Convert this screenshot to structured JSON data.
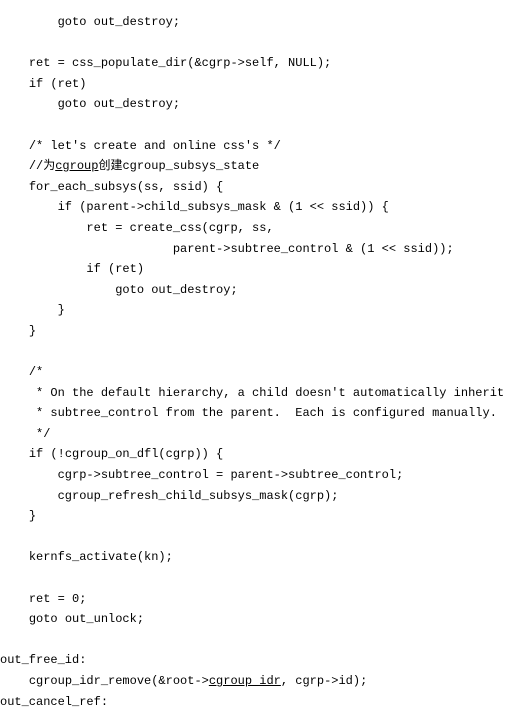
{
  "lines": [
    {
      "indent": 8,
      "segments": [
        {
          "t": "goto out_destroy;"
        }
      ]
    },
    {
      "blank": true
    },
    {
      "indent": 4,
      "segments": [
        {
          "t": "ret = css_populate_dir(&cgrp->self, NULL);"
        }
      ]
    },
    {
      "indent": 4,
      "segments": [
        {
          "t": "if (ret)"
        }
      ]
    },
    {
      "indent": 8,
      "segments": [
        {
          "t": "goto out_destroy;"
        }
      ]
    },
    {
      "blank": true
    },
    {
      "indent": 4,
      "segments": [
        {
          "t": "/* let's create and online css's */"
        }
      ]
    },
    {
      "indent": 4,
      "segments": [
        {
          "t": "//为"
        },
        {
          "t": "cgroup",
          "u": true
        },
        {
          "t": "创建cgroup_subsys_state"
        }
      ]
    },
    {
      "indent": 4,
      "segments": [
        {
          "t": "for_each_subsys(ss, ssid) {"
        }
      ]
    },
    {
      "indent": 8,
      "segments": [
        {
          "t": "if (parent->child_subsys_mask & (1 << ssid)) {"
        }
      ]
    },
    {
      "indent": 12,
      "segments": [
        {
          "t": "ret = create_css(cgrp, ss,"
        }
      ]
    },
    {
      "indent": 24,
      "segments": [
        {
          "t": "parent->subtree_control & (1 << ssid));"
        }
      ]
    },
    {
      "indent": 12,
      "segments": [
        {
          "t": "if (ret)"
        }
      ]
    },
    {
      "indent": 16,
      "segments": [
        {
          "t": "goto out_destroy;"
        }
      ]
    },
    {
      "indent": 8,
      "segments": [
        {
          "t": "}"
        }
      ]
    },
    {
      "indent": 4,
      "segments": [
        {
          "t": "}"
        }
      ]
    },
    {
      "blank": true
    },
    {
      "indent": 4,
      "segments": [
        {
          "t": "/*"
        }
      ]
    },
    {
      "indent": 5,
      "segments": [
        {
          "t": "* On the default hierarchy, a child doesn't automatically inherit"
        }
      ]
    },
    {
      "indent": 5,
      "segments": [
        {
          "t": "* subtree_control from the parent.  Each is configured manually."
        }
      ]
    },
    {
      "indent": 5,
      "segments": [
        {
          "t": "*/"
        }
      ]
    },
    {
      "indent": 4,
      "segments": [
        {
          "t": "if (!cgroup_on_dfl(cgrp)) {"
        }
      ]
    },
    {
      "indent": 8,
      "segments": [
        {
          "t": "cgrp->subtree_control = parent->subtree_control;"
        }
      ]
    },
    {
      "indent": 8,
      "segments": [
        {
          "t": "cgroup_refresh_child_subsys_mask(cgrp);"
        }
      ]
    },
    {
      "indent": 4,
      "segments": [
        {
          "t": "}"
        }
      ]
    },
    {
      "blank": true
    },
    {
      "indent": 4,
      "segments": [
        {
          "t": "kernfs_activate(kn);"
        }
      ]
    },
    {
      "blank": true
    },
    {
      "indent": 4,
      "segments": [
        {
          "t": "ret = 0;"
        }
      ]
    },
    {
      "indent": 4,
      "segments": [
        {
          "t": "goto out_unlock;"
        }
      ]
    },
    {
      "blank": true
    },
    {
      "indent": 0,
      "segments": [
        {
          "t": "out_free_id:"
        }
      ]
    },
    {
      "indent": 4,
      "segments": [
        {
          "t": "cgroup_idr_remove(&root->"
        },
        {
          "t": "cgroup idr",
          "u": true
        },
        {
          "t": ", cgrp->id);"
        }
      ]
    },
    {
      "indent": 0,
      "segments": [
        {
          "t": "out_cancel_ref:"
        }
      ]
    }
  ]
}
